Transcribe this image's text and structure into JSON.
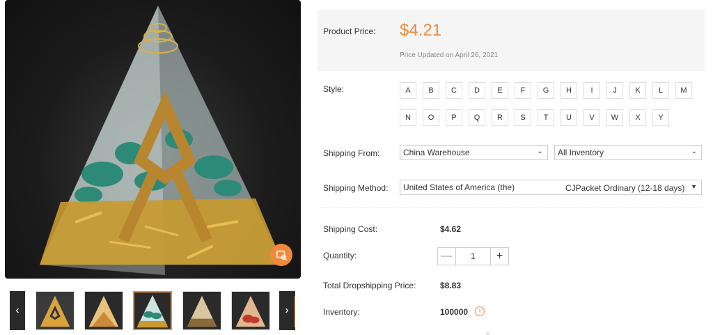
{
  "gallery": {
    "main_image_alt": "pyramid-image",
    "thumb_count": 6,
    "active_thumb": 2,
    "prev_arrow": "‹",
    "next_arrow": "›"
  },
  "price": {
    "label": "Product Price:",
    "value": "$4.21",
    "updated": "Price Updated on April 26, 2021"
  },
  "style": {
    "label": "Style:",
    "options": [
      "A",
      "B",
      "C",
      "D",
      "E",
      "F",
      "G",
      "H",
      "I",
      "J",
      "K",
      "L",
      "M",
      "N",
      "O",
      "P",
      "Q",
      "R",
      "S",
      "T",
      "U",
      "V",
      "W",
      "X",
      "Y"
    ]
  },
  "shipping_from": {
    "label": "Shipping From:",
    "warehouse": "China Warehouse",
    "inventory": "All Inventory"
  },
  "shipping_method": {
    "label": "Shipping Method:",
    "country": "United States of America (the)",
    "method": "CJPacket Ordinary (12-18 days)"
  },
  "shipping_cost": {
    "label": "Shipping Cost:",
    "value": "$4.62"
  },
  "quantity": {
    "label": "Quantity:",
    "value": "1",
    "minus": "—",
    "plus": "+"
  },
  "total": {
    "label": "Total Dropshipping Price:",
    "value": "$8.83"
  },
  "inventory": {
    "label": "Inventory:",
    "value": "100000",
    "icon": "!"
  },
  "colors": {
    "accent": "#f08a3a",
    "price_box_bg": "#f5f5f5"
  }
}
